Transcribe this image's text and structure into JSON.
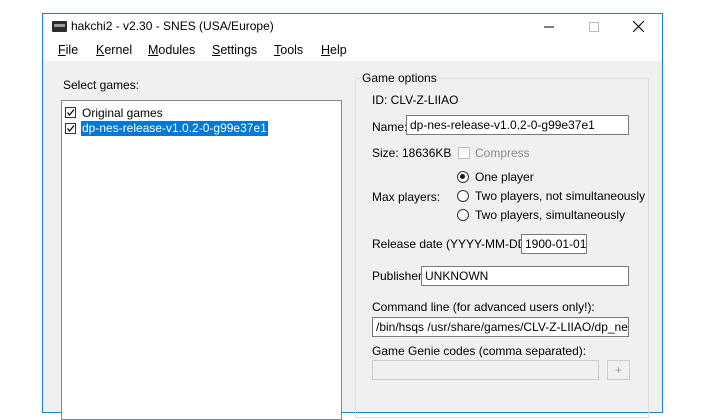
{
  "window": {
    "title": "hakchi2 - v2.30 - SNES (USA/Europe)"
  },
  "controls": {
    "minimize": "minimize",
    "maximize": "maximize",
    "close": "close"
  },
  "menu": [
    {
      "first": "F",
      "rest": "ile"
    },
    {
      "first": "K",
      "rest": "ernel"
    },
    {
      "first": "M",
      "rest": "odules"
    },
    {
      "first": "S",
      "rest": "ettings"
    },
    {
      "first": "T",
      "rest": "ools"
    },
    {
      "first": "H",
      "rest": "elp"
    }
  ],
  "games": {
    "label": "Select games:",
    "items": [
      {
        "label": "Original games",
        "checked": true,
        "selected": false
      },
      {
        "label": "dp-nes-release-v1.0.2-0-g99e37e1",
        "checked": true,
        "selected": true
      }
    ]
  },
  "options": {
    "group_title": "Game options",
    "id_text": "ID: CLV-Z-LIIAO",
    "name_label": "Name:",
    "name_value": "dp-nes-release-v1.0.2-0-g99e37e1",
    "size_text": "Size: 18636KB",
    "compress_label": "Compress",
    "compress_checked": false,
    "max_players_label": "Max players:",
    "players_options": [
      "One player",
      "Two players, not simultaneously",
      "Two players, simultaneously"
    ],
    "players_selected": 0,
    "release_label": "Release date (YYYY-MM-DD):",
    "release_value": "1900-01-01",
    "publisher_label": "Publisher:",
    "publisher_value": "UNKNOWN",
    "command_label": "Command line (for advanced users only!):",
    "command_value": "/bin/hsqs /usr/share/games/CLV-Z-LIIAO/dp_nes_re",
    "genie_label": "Game Genie codes (comma separated):",
    "genie_value": "",
    "genie_button": "+"
  },
  "colors": {
    "selection": "#0078d7",
    "window_border": "#1883d7"
  }
}
